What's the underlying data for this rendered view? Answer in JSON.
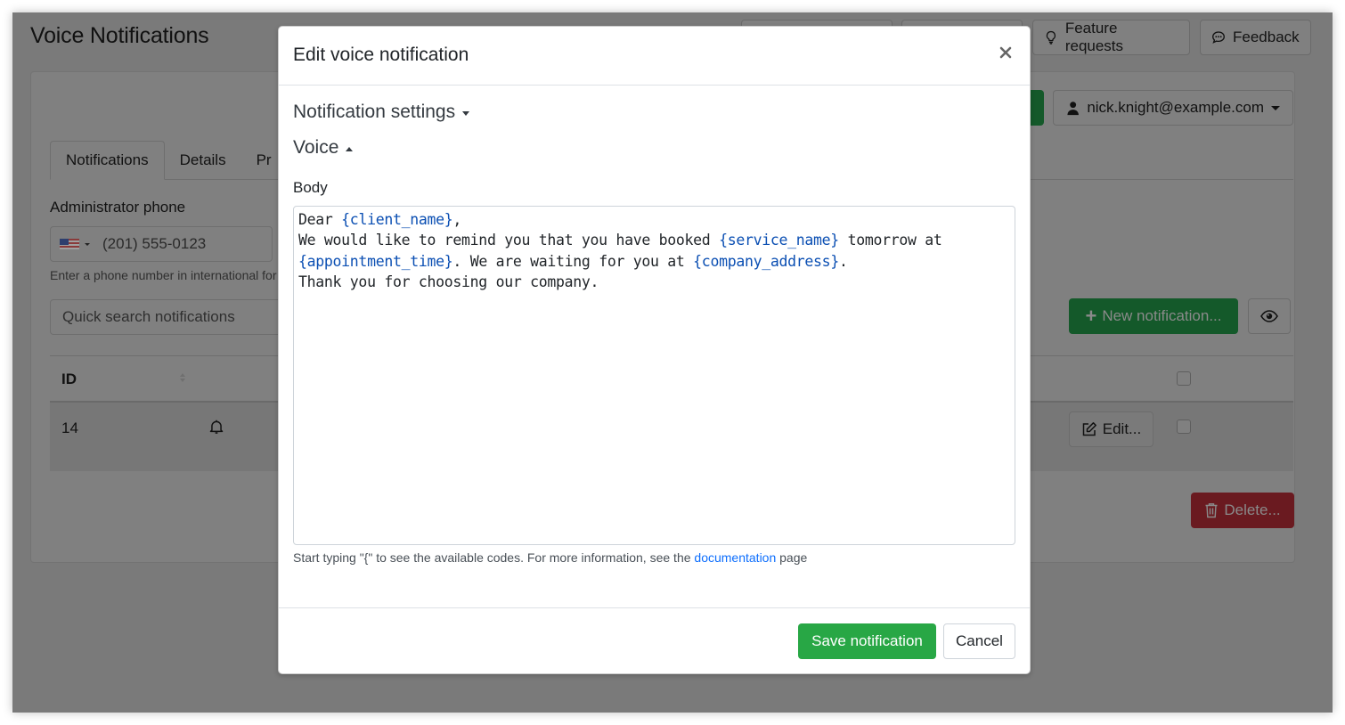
{
  "page": {
    "title": "Voice Notifications",
    "top_buttons": [
      {
        "label": "",
        "icon": "unknown"
      },
      {
        "label": "",
        "icon": "unknown"
      },
      {
        "label": "Feature requests",
        "icon": "lightbulb-icon"
      },
      {
        "label": "Feedback",
        "icon": "chat-icon"
      }
    ],
    "user_menu": {
      "label": "nick.knight@example.com",
      "icon": "user-icon"
    },
    "tabs": [
      {
        "label": "Notifications",
        "active": true
      },
      {
        "label": "Details",
        "active": false
      },
      {
        "label": "Pr",
        "active": false
      }
    ],
    "admin_phone": {
      "label": "Administrator phone",
      "country": "US",
      "placeholder": "(201) 555-0123",
      "help": "Enter a phone number in international for"
    },
    "search": {
      "placeholder": "Quick search notifications"
    },
    "new_notification_label": "New notification...",
    "table": {
      "columns": [
        "ID"
      ],
      "rows": [
        {
          "id": "14",
          "icon": "bell-icon",
          "edit_label": "Edit..."
        }
      ]
    },
    "delete_label": "Delete..."
  },
  "modal": {
    "title": "Edit voice notification",
    "sections": [
      {
        "label": "Notification settings",
        "expanded": false
      },
      {
        "label": "Voice",
        "expanded": true
      }
    ],
    "body_label": "Body",
    "body_segments": [
      {
        "text": "Dear ",
        "code": false
      },
      {
        "text": "{client_name}",
        "code": true
      },
      {
        "text": ",\nWe would like to remind you that you have booked ",
        "code": false
      },
      {
        "text": "{service_name}",
        "code": true
      },
      {
        "text": " tomorrow at\n",
        "code": false
      },
      {
        "text": "{appointment_time}",
        "code": true
      },
      {
        "text": ". We are waiting for you at ",
        "code": false
      },
      {
        "text": "{company_address}",
        "code": true
      },
      {
        "text": ".\nThank you for choosing our company.",
        "code": false
      }
    ],
    "hint_before": "Start typing \"{\" to see the available codes. For more information, see the ",
    "hint_link": "documentation",
    "hint_after": " page",
    "save_label": "Save notification",
    "cancel_label": "Cancel"
  },
  "colors": {
    "overlay": "#7a7a7a",
    "success": "#28a745",
    "danger_dimmed": "#6a1a20",
    "link": "#0d6efd",
    "code": "#0b4fb3"
  }
}
